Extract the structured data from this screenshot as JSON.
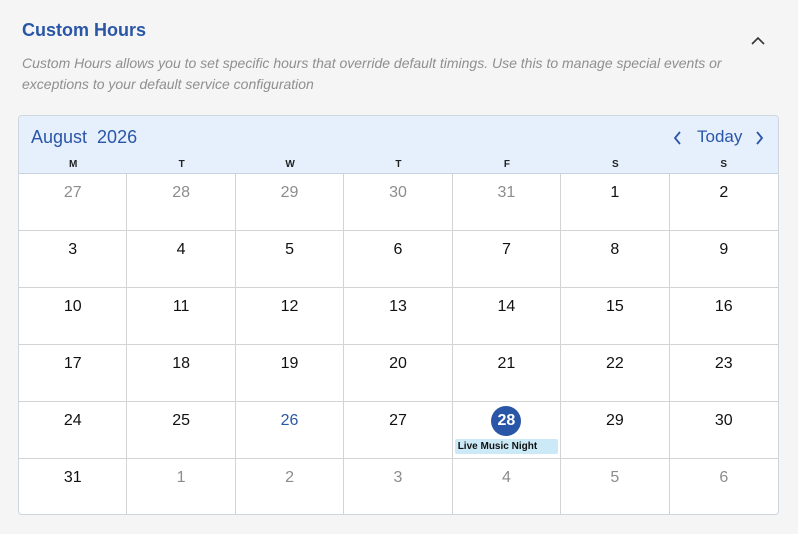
{
  "header": {
    "title": "Custom Hours",
    "description": "Custom Hours allows you to set specific hours that override default timings. Use this to manage special events or exceptions to your default service configuration"
  },
  "calendar": {
    "month_label": "August  2026",
    "today_label": "Today",
    "weekdays": [
      "M",
      "T",
      "W",
      "T",
      "F",
      "S",
      "S"
    ],
    "days": [
      {
        "n": "27",
        "muted": true
      },
      {
        "n": "28",
        "muted": true
      },
      {
        "n": "29",
        "muted": true
      },
      {
        "n": "30",
        "muted": true
      },
      {
        "n": "31",
        "muted": true
      },
      {
        "n": "1"
      },
      {
        "n": "2"
      },
      {
        "n": "3"
      },
      {
        "n": "4"
      },
      {
        "n": "5"
      },
      {
        "n": "6"
      },
      {
        "n": "7"
      },
      {
        "n": "8"
      },
      {
        "n": "9"
      },
      {
        "n": "10"
      },
      {
        "n": "11"
      },
      {
        "n": "12"
      },
      {
        "n": "13"
      },
      {
        "n": "14"
      },
      {
        "n": "15"
      },
      {
        "n": "16"
      },
      {
        "n": "17"
      },
      {
        "n": "18"
      },
      {
        "n": "19"
      },
      {
        "n": "20"
      },
      {
        "n": "21"
      },
      {
        "n": "22"
      },
      {
        "n": "23"
      },
      {
        "n": "24"
      },
      {
        "n": "25"
      },
      {
        "n": "26",
        "highlight": true
      },
      {
        "n": "27"
      },
      {
        "n": "28",
        "selected": true,
        "event": "Live Music Night"
      },
      {
        "n": "29"
      },
      {
        "n": "30"
      },
      {
        "n": "31"
      },
      {
        "n": "1",
        "muted": true
      },
      {
        "n": "2",
        "muted": true
      },
      {
        "n": "3",
        "muted": true
      },
      {
        "n": "4",
        "muted": true
      },
      {
        "n": "5",
        "muted": true
      },
      {
        "n": "6",
        "muted": true
      }
    ]
  },
  "icons": {
    "collapse": "chevron-up-icon",
    "prev": "chevron-left-icon",
    "next": "chevron-right-icon"
  },
  "colors": {
    "accent": "#2a56a8",
    "header_bg": "#e6f0fd",
    "event_bg": "#cbe9f7"
  }
}
